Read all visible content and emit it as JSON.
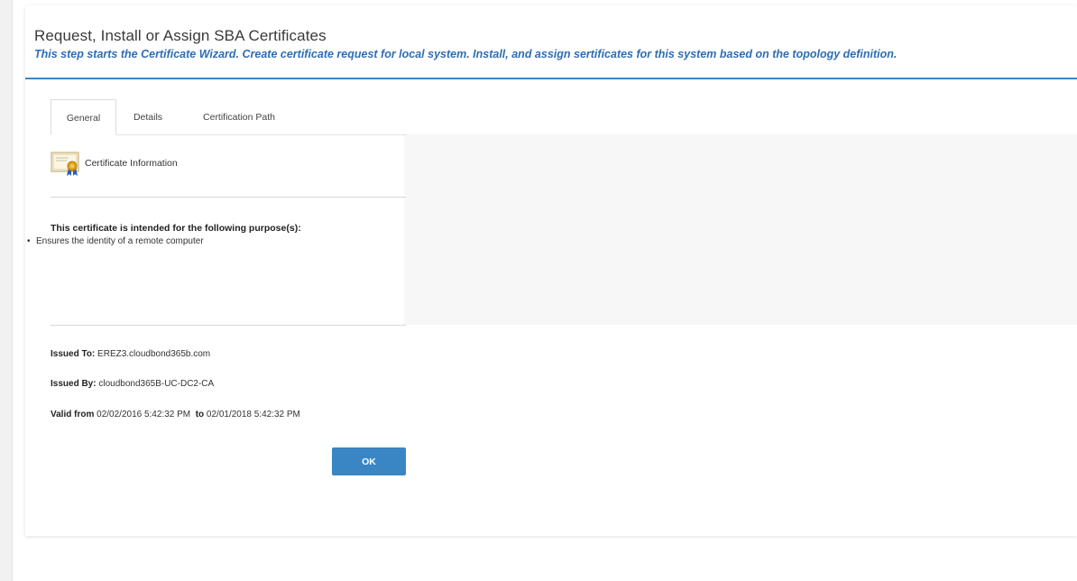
{
  "header": {
    "title": "Request, Install or Assign SBA Certificates",
    "subtitle": "This step starts the Certificate Wizard. Create certificate request for local system. Install, and assign sertificates for this system based on the topology definition."
  },
  "tabs": [
    {
      "label": "General",
      "active": true
    },
    {
      "label": "Details",
      "active": false
    },
    {
      "label": "Certification Path",
      "active": false
    }
  ],
  "certificate": {
    "info_label": "Certificate Information",
    "purpose_heading": "This certificate is intended for the following purpose(s):",
    "purposes": [
      "Ensures the identity of a remote computer"
    ],
    "issued_to_label": "Issued To:",
    "issued_to": "EREZ3.cloudbond365b.com",
    "issued_by_label": "Issued By:",
    "issued_by": "cloudbond365B-UC-DC2-CA",
    "valid_from_label": "Valid from",
    "valid_from": "02/02/2016 5:42:32 PM",
    "valid_to_label": "to",
    "valid_to": "02/01/2018 5:42:32 PM"
  },
  "buttons": {
    "ok_label": "OK"
  },
  "colors": {
    "accent": "#3d85c6",
    "subtitle": "#2f6db3",
    "button": "#3a86c4"
  },
  "icons": {
    "certificate": "certificate-icon"
  }
}
